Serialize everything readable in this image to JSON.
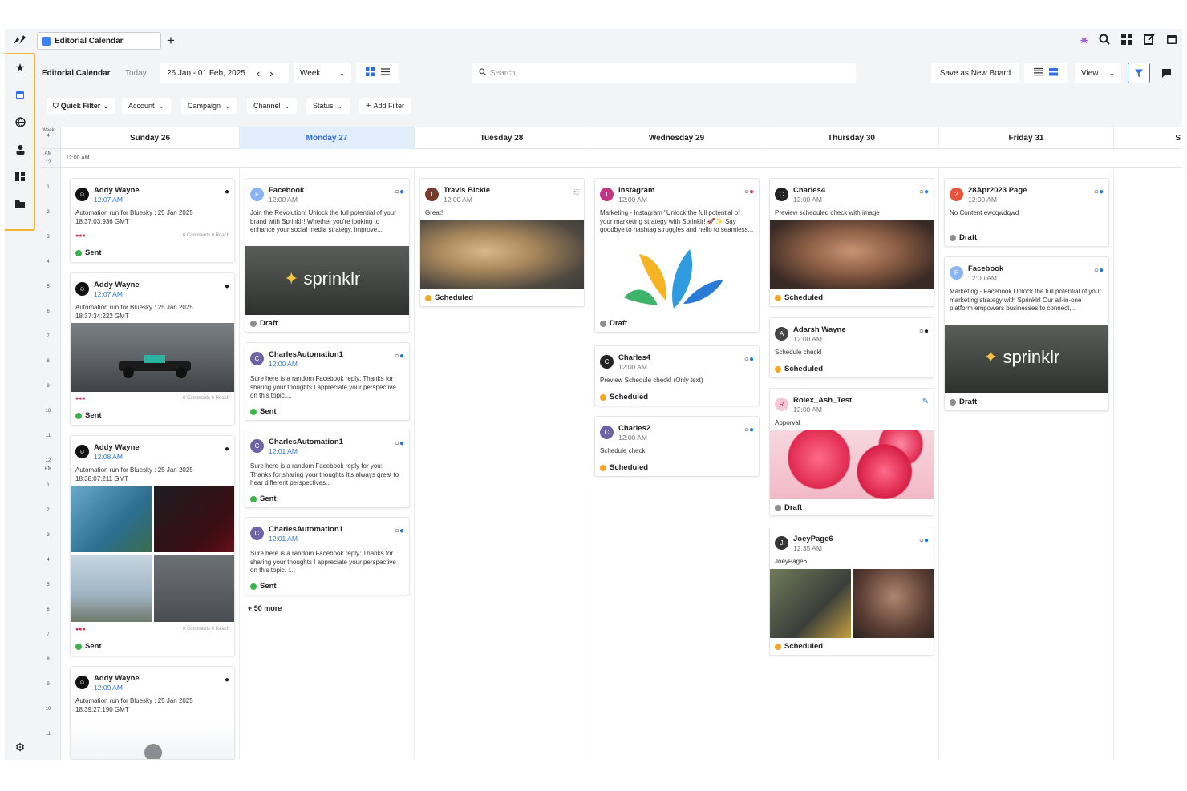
{
  "app": {
    "tab_title": "Editorial Calendar"
  },
  "toolbar": {
    "title": "Editorial Calendar",
    "today": "Today",
    "date_range": "26 Jan - 01 Feb, 2025",
    "prev": "‹",
    "next": "›",
    "view_mode": "Week",
    "search_placeholder": "Search",
    "save_board": "Save as New Board",
    "view": "View"
  },
  "filters": {
    "quick": "Quick Filter",
    "account": "Account",
    "campaign": "Campaign",
    "channel": "Channel",
    "status": "Status",
    "add": "Add Filter"
  },
  "calendar": {
    "week_label": "Week",
    "week_num": "4",
    "ampm_am": "AM",
    "ampm_pm": "PM",
    "allday_time": "12:00 AM",
    "days": [
      "Sunday 26",
      "Monday 27",
      "Tuesday 28",
      "Wednesday 29",
      "Thursday 30",
      "Friday 31",
      "S"
    ],
    "hours": [
      "12",
      "1",
      "2",
      "3",
      "4",
      "5",
      "6",
      "7",
      "8",
      "9",
      "10",
      "11",
      "12",
      "1",
      "2",
      "3",
      "4",
      "5",
      "6",
      "7",
      "8",
      "9",
      "10",
      "11"
    ]
  },
  "status_colors": {
    "Sent": "#3ab54a",
    "Draft": "#8e8e93",
    "Scheduled": "#f5a623"
  },
  "cards": {
    "sun1": {
      "name": "Addy Wayne",
      "time": "12:07 AM",
      "body": "Automation run for Bluesky : 25 Jan 2025 18:37:03:936 GMT",
      "meta": "0 Comments 0 Reach",
      "status": "Sent"
    },
    "sun2": {
      "name": "Addy Wayne",
      "time": "12:07 AM",
      "body": "Automation run for Bluesky : 25 Jan 2025 18:37:34:222 GMT",
      "meta": "0 Comments 0 Reach",
      "status": "Sent"
    },
    "sun3": {
      "name": "Addy Wayne",
      "time": "12:08 AM",
      "body": "Automation run for Bluesky : 25 Jan 2025 18:38:07:211 GMT",
      "meta": "0 Comments 0 Reach",
      "status": "Sent"
    },
    "sun4": {
      "name": "Addy Wayne",
      "time": "12:09 AM",
      "body": "Automation run for Bluesky : 25 Jan 2025 18:39:27:190 GMT"
    },
    "mon1": {
      "name": "Facebook",
      "time": "12:00 AM",
      "body": "Join the Revolution! Unlock the full potential of your brand with Sprinklr! Whether you're looking to enhance your social media strategy, improve...",
      "brand": "sprinklr",
      "status": "Draft"
    },
    "mon2": {
      "name": "CharlesAutomation1",
      "time": "12:00 AM",
      "body": "Sure here is a random Facebook reply: Thanks for sharing your thoughts I appreciate your perspective on this topic....",
      "status": "Sent"
    },
    "mon3": {
      "name": "CharlesAutomation1",
      "time": "12:01 AM",
      "body": "Sure here is a random Facebook reply for you: Thanks for sharing your thoughts It's always great to hear different perspectives...",
      "status": "Sent"
    },
    "mon4": {
      "name": "CharlesAutomation1",
      "time": "12:01 AM",
      "body": "Sure here is a random Facebook reply: Thanks for sharing your thoughts I appreciate your perspective on this topic. :...",
      "status": "Sent"
    },
    "mon_more": "+ 50 more",
    "tue1": {
      "name": "Travis Bickle",
      "time": "12:00 AM",
      "body": "Great!",
      "status": "Scheduled"
    },
    "wed1": {
      "name": "Instagram",
      "time": "12:00 AM",
      "body": "Marketing - Instagram \"Unlock the full potential of your marketing strategy with Sprinklr! 🚀✨ Say goodbye to hashtag struggles and hello to seamless...",
      "status": "Draft"
    },
    "wed2": {
      "name": "Charles4",
      "time": "12:00 AM",
      "body": "Preview Schedule check! (Only text)",
      "status": "Scheduled"
    },
    "wed3": {
      "name": "Charles2",
      "time": "12:00 AM",
      "body": "Schedule check!",
      "status": "Scheduled"
    },
    "thu1": {
      "name": "Charles4",
      "time": "12:00 AM",
      "body": "Preview scheduled check with image",
      "status": "Scheduled"
    },
    "thu2": {
      "name": "Adarsh Wayne",
      "time": "12:00 AM",
      "body": "Schedule check!",
      "status": "Scheduled"
    },
    "thu3": {
      "name": "Rolex_Ash_Test",
      "time": "12:00 AM",
      "body": "Apporval",
      "avatar_letter": "R",
      "status": "Draft"
    },
    "thu4": {
      "name": "JoeyPage6",
      "time": "12:35 AM",
      "body": "JoeyPage6",
      "status": "Scheduled"
    },
    "fri1": {
      "name": "28Apr2023 Page",
      "time": "12:00 AM",
      "body": "No Content ewcqwdqwd",
      "status": "Draft"
    },
    "fri2": {
      "name": "Facebook",
      "time": "12:00 AM",
      "body": "Marketing - Facebook Unlock the full potential of your marketing strategy with Sprinklr! Our all-in-one platform empowers businesses to connect,...",
      "brand": "sprinklr",
      "status": "Draft"
    }
  }
}
